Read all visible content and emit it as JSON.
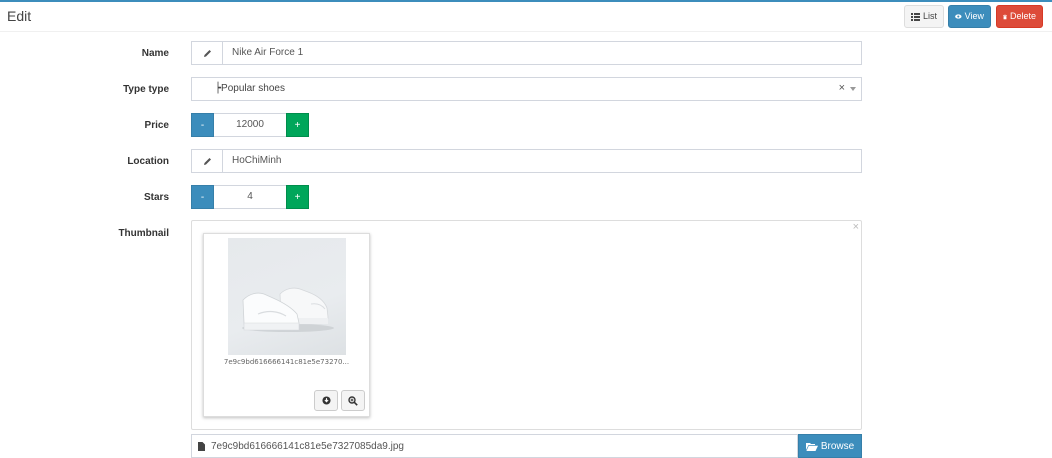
{
  "header": {
    "title": "Edit",
    "list_label": "List",
    "view_label": "View",
    "delete_label": "Delete"
  },
  "form": {
    "name": {
      "label": "Name",
      "value": "Nike Air Force 1"
    },
    "type": {
      "label": "Type type",
      "value": "┝Popular shoes",
      "clear": "×"
    },
    "price": {
      "label": "Price",
      "value": "12000",
      "minus": "-",
      "plus": "+"
    },
    "location": {
      "label": "Location",
      "value": "HoChiMinh"
    },
    "stars": {
      "label": "Stars",
      "value": "4",
      "minus": "-",
      "plus": "+"
    },
    "thumbnail": {
      "label": "Thumbnail",
      "close": "×",
      "preview_caption": "7e9c9bd616666141c81e5e73270...",
      "file_name": "7e9c9bd616666141c81e5e7327085da9.jpg",
      "browse_label": "Browse"
    }
  },
  "icons": [
    "list-icon",
    "eye-icon",
    "trash-icon",
    "pencil-icon",
    "file-icon",
    "folder-open-icon",
    "download-icon",
    "zoom-in-icon",
    "caret-down-icon"
  ],
  "colors": {
    "primary": "#3c8dbc",
    "success": "#00a65a",
    "danger": "#dd4b39",
    "top_border": "#3c8dbc"
  }
}
